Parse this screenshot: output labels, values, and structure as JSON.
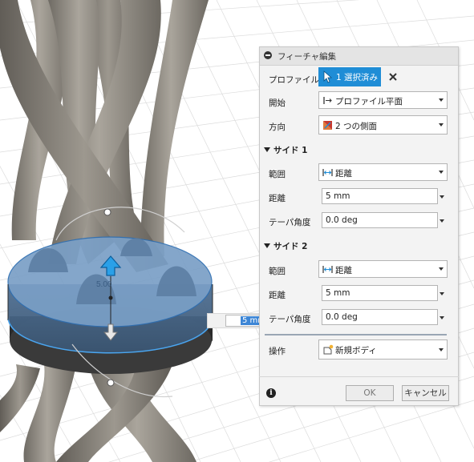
{
  "canvas": {
    "manipulator_value": "5.00",
    "distance_input_value": "5 mm"
  },
  "dialog": {
    "title": "フィーチャ編集",
    "profile": {
      "label": "プロファイル",
      "button_label": "1 選択済み"
    },
    "start": {
      "label": "開始",
      "value": "プロファイル平面"
    },
    "direction": {
      "label": "方向",
      "value": "2 つの側面"
    },
    "side1": {
      "header": "サイド 1",
      "extent": {
        "label": "範囲",
        "value": "距離"
      },
      "distance": {
        "label": "距離",
        "value": "5 mm"
      },
      "taper": {
        "label": "テーパ角度",
        "value": "0.0 deg"
      }
    },
    "side2": {
      "header": "サイド 2",
      "extent": {
        "label": "範囲",
        "value": "距離"
      },
      "distance": {
        "label": "距離",
        "value": "5 mm"
      },
      "taper": {
        "label": "テーパ角度",
        "value": "0.0 deg"
      }
    },
    "operation": {
      "label": "操作",
      "value": "新規ボディ"
    },
    "ok_label": "OK",
    "cancel_label": "キャンセル"
  },
  "colors": {
    "selection_blue": "#1f8dd6",
    "rod_gray": "#8a857c",
    "disk_face_blue": "#6d95bd"
  }
}
